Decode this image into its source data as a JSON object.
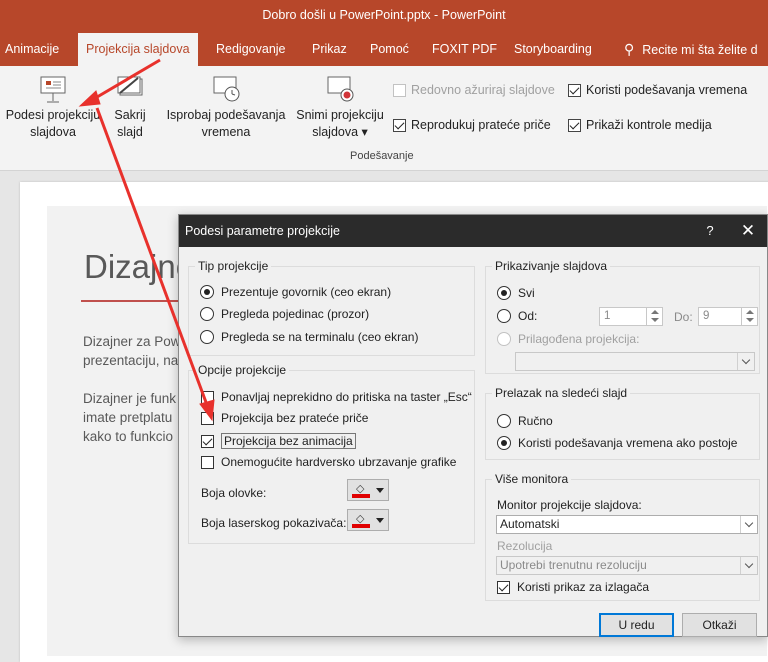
{
  "window": {
    "title": "Dobro došli u PowerPoint.pptx  -  PowerPoint"
  },
  "tabs": [
    {
      "label": "Animacije"
    },
    {
      "label": "Projekcija slajdova",
      "active": true
    },
    {
      "label": "Redigovanje"
    },
    {
      "label": "Prikaz"
    },
    {
      "label": "Pomoć"
    },
    {
      "label": "FOXIT PDF"
    },
    {
      "label": "Storyboarding"
    },
    {
      "label": "Recite mi šta želite d"
    }
  ],
  "ribbon": {
    "setup_show": {
      "line1": "Podesi projekciju",
      "line2": "slajdova"
    },
    "hide_slide": {
      "line1": "Sakrij",
      "line2": "slajd"
    },
    "rehearse": {
      "line1": "Isprobaj podešavanja",
      "line2": "vremena"
    },
    "record": {
      "line1": "Snimi projekciju",
      "line2": "slajdova ▾"
    },
    "keep_updated": {
      "label": "Redovno ažuriraj slajdove",
      "checked": false,
      "enabled": false
    },
    "play_narrations": {
      "label": "Reprodukuj prateće priče",
      "checked": true
    },
    "use_timings": {
      "label": "Koristi podešavanja vremena",
      "checked": true
    },
    "show_media": {
      "label": "Prikaži kontrole medija",
      "checked": true
    },
    "group_label": "Podešavanje"
  },
  "slide": {
    "title": "Dizajne",
    "para1": [
      "Dizajner za Pow",
      "prezentaciju, na"
    ],
    "para2": [
      "Dizajner je funk",
      "imate pretplatu",
      "kako to funkcio"
    ]
  },
  "dialog": {
    "title": "Podesi parametre projekcije",
    "help": "?",
    "close": "✕",
    "show_type": {
      "legend": "Tip projekcije",
      "options": [
        {
          "label": "Prezentuje govornik (ceo ekran)",
          "selected": true
        },
        {
          "label": "Pregleda pojedinac (prozor)",
          "selected": false
        },
        {
          "label": "Pregleda se na terminalu (ceo ekran)",
          "selected": false
        }
      ]
    },
    "show_options": {
      "legend": "Opcije projekcije",
      "loop": {
        "label": "Ponavljaj neprekidno do pritiska na taster „Esc“",
        "checked": false
      },
      "no_narration": {
        "label": "Projekcija bez prateće priče",
        "checked": false
      },
      "no_animation": {
        "label": "Projekcija bez animacija",
        "checked": true
      },
      "no_hw_accel": {
        "label": "Onemogućite hardversko ubrzavanje grafike",
        "checked": false
      },
      "pen_color_label": "Boja olovke:",
      "laser_color_label": "Boja laserskog pokazivača:",
      "pen_color": "#e00000",
      "laser_color": "#e00000"
    },
    "show_slides": {
      "legend": "Prikazivanje slajdova",
      "all": {
        "label": "Svi",
        "selected": true
      },
      "from": {
        "label": "Od:",
        "selected": false,
        "value": "1"
      },
      "to": {
        "label": "Do:",
        "value": "9"
      },
      "custom": {
        "label": "Prilagođena projekcija:",
        "selected": false,
        "enabled": false
      }
    },
    "advance": {
      "legend": "Prelazak na sledeći slajd",
      "manual": {
        "label": "Ručno",
        "selected": false
      },
      "timings": {
        "label": "Koristi podešavanja vremena ako postoje",
        "selected": true
      }
    },
    "monitors": {
      "legend": "Više monitora",
      "monitor_label": "Monitor projekcije slajdova:",
      "monitor_value": "Automatski",
      "resolution_label": "Rezolucija",
      "resolution_value": "Upotrebi trenutnu rezoluciju",
      "presenter_view": {
        "label": "Koristi prikaz za izlagača",
        "checked": true
      }
    },
    "ok": "U redu",
    "cancel": "Otkaži"
  },
  "annotation": {
    "arrow_color": "#e8312c"
  }
}
